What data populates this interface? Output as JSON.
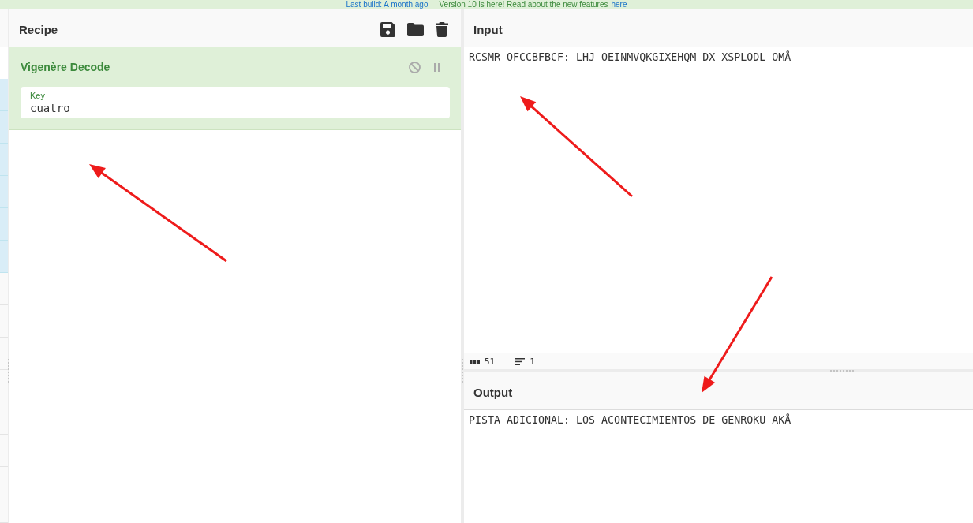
{
  "banner": {
    "build_link": "Last build: A month ago",
    "message": "Version 10 is here! Read about the new features",
    "features_link": "here"
  },
  "operations_pane": {
    "rows": [
      {
        "highlighted": true
      },
      {
        "highlighted": true
      },
      {
        "highlighted": true
      },
      {
        "highlighted": true
      },
      {
        "highlighted": true
      },
      {
        "highlighted": true
      },
      {
        "highlighted": false
      },
      {
        "highlighted": false
      },
      {
        "highlighted": false
      },
      {
        "highlighted": false
      },
      {
        "highlighted": false
      },
      {
        "highlighted": false
      },
      {
        "highlighted": false
      },
      {
        "highlighted": false
      }
    ]
  },
  "recipe": {
    "title": "Recipe",
    "operations": [
      {
        "name": "Vigenère Decode",
        "disabled": false,
        "breakpoint": false,
        "args": [
          {
            "label": "Key",
            "value": "cuatro"
          }
        ]
      }
    ]
  },
  "input": {
    "title": "Input",
    "text": "RCSMR OFCCBFBCF: LHJ OEINMVQKGIXEHQM DX XSPLODL OMÅ",
    "status": {
      "length": "51",
      "lines": "1"
    }
  },
  "output": {
    "title": "Output",
    "text": "PISTA ADICIONAL: LOS ACONTECIMIENTOS DE GENROKU AKÅ"
  },
  "annotations": [
    {
      "kind": "arrow"
    },
    {
      "kind": "arrow"
    },
    {
      "kind": "arrow"
    }
  ]
}
